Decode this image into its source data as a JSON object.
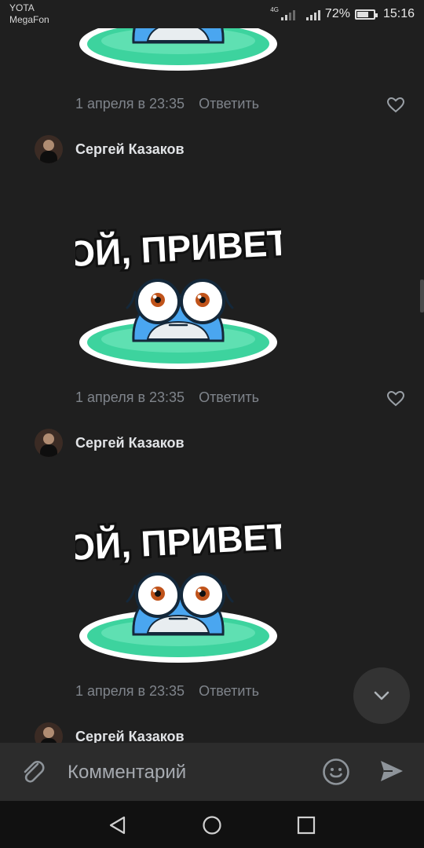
{
  "status_bar": {
    "carrier_1": "YOTA",
    "carrier_2": "MegaFon",
    "network": "4G",
    "battery": "72%",
    "battery_level": 0.72,
    "time": "15:16"
  },
  "comments": [
    {
      "id": "c1",
      "author": "",
      "date": "1 апреля в 23:35",
      "reply_label": "Ответить",
      "sticker_text": "",
      "liked": false
    },
    {
      "id": "c2",
      "author": "Сергей Казаков",
      "date": "1 апреля в 23:35",
      "reply_label": "Ответить",
      "sticker_text": "ОЙ, ПРИВЕТ",
      "liked": false
    },
    {
      "id": "c3",
      "author": "Сергей Казаков",
      "date": "1 апреля в 23:35",
      "reply_label": "Ответить",
      "sticker_text": "ОЙ, ПРИВЕТ",
      "liked": false
    },
    {
      "id": "c4",
      "author": "Сергей Казаков"
    }
  ],
  "composer": {
    "placeholder": "Комментарий",
    "attach_icon": "paperclip-icon",
    "emoji_icon": "emoji-icon",
    "send_icon": "send-icon"
  },
  "scroll_down_icon": "chevron-down-icon",
  "navigation": {
    "back_icon": "back-triangle-icon",
    "home_icon": "home-circle-icon",
    "recents_icon": "recents-square-icon"
  },
  "colors": {
    "background": "#1f1f1f",
    "text_primary": "#e1e3e6",
    "text_secondary": "#7f848b",
    "composer_bg": "#2c2c2c",
    "sticker_pond": "#3dd39e",
    "sticker_frog": "#4aa6f0"
  }
}
